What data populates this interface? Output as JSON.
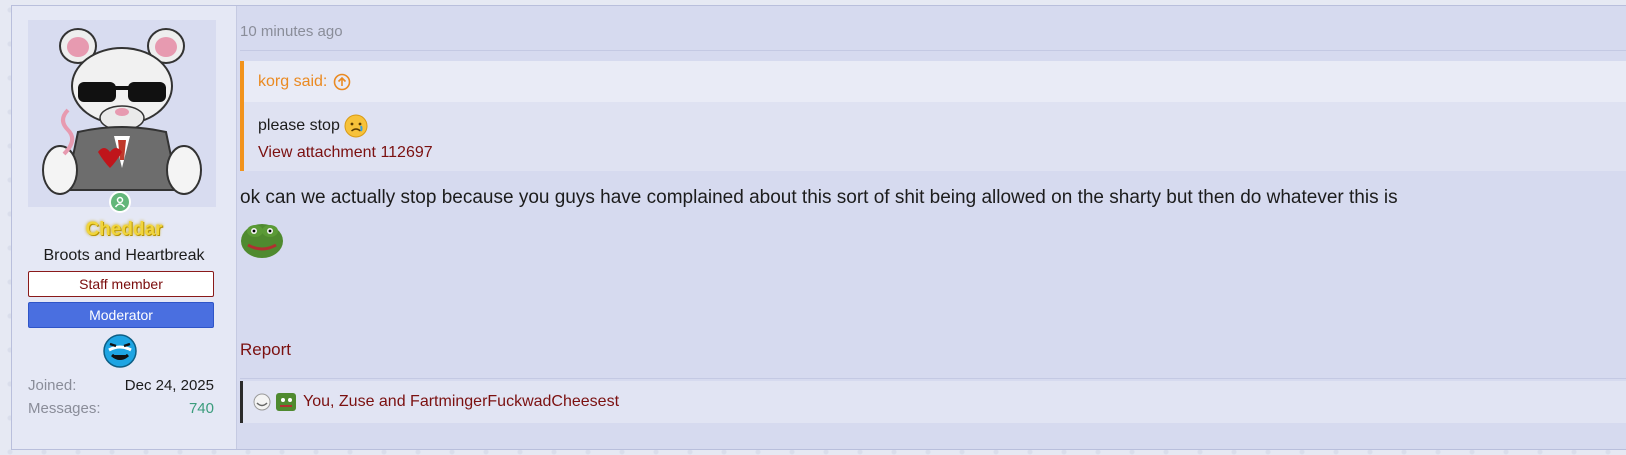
{
  "author": {
    "username": "Cheddar",
    "user_title": "Broots and Heartbreak",
    "banners": [
      "Staff member",
      "Moderator"
    ],
    "stats": [
      {
        "label": "Joined:",
        "value": "Dec 24, 2025"
      },
      {
        "label": "Messages:",
        "value": "740"
      }
    ],
    "avatar_icon": "rat-with-sunglasses-avatar",
    "online_icon": "online-user-icon"
  },
  "post": {
    "time": "10 minutes ago",
    "quote": {
      "author": "korg said:",
      "text": "please stop",
      "attachment_link": "View attachment 112697"
    },
    "message": "ok can we actually stop because you guys have complained about this sort of shit being allowed on the sharty but then do whatever this is",
    "report_label": "Report",
    "reactions_text": "You, Zuse and FartmingerFuckwadCheesest"
  },
  "colors": {
    "accent_quote": "#f2931c",
    "link": "#7b1010",
    "username": "#f1d53c",
    "moderator_banner": "#4a6fe0"
  }
}
